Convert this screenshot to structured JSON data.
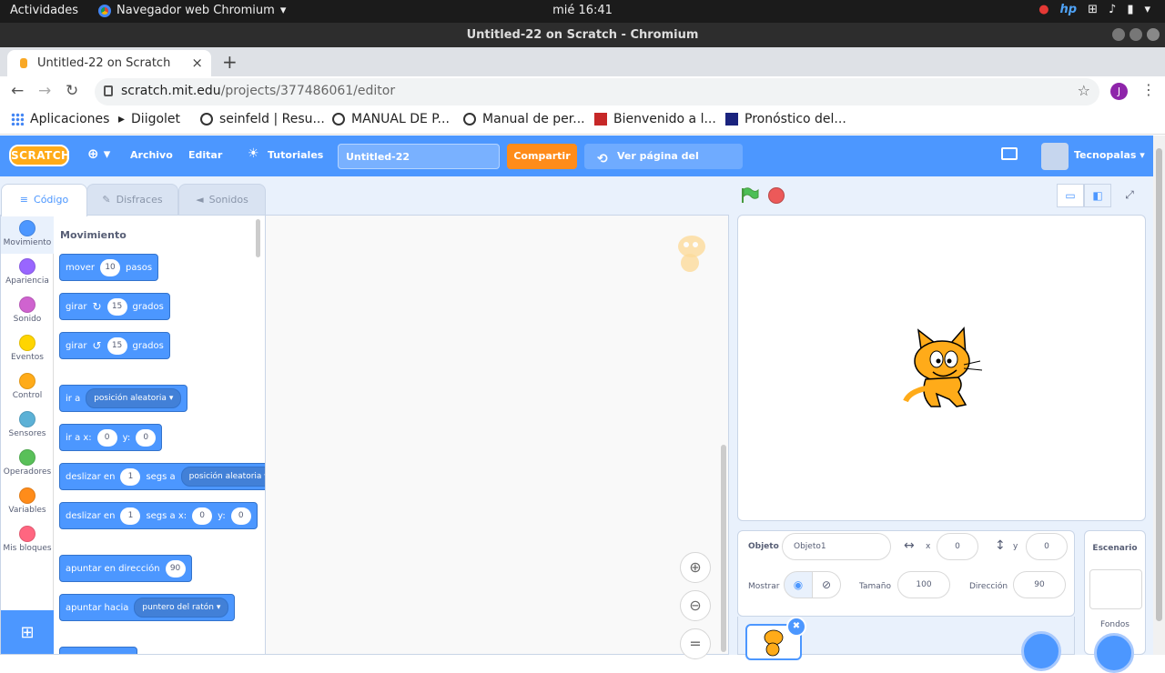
{
  "os": {
    "activities": "Actividades",
    "app_menu": "Navegador web Chromium",
    "clock": "mié 16:41"
  },
  "window": {
    "title": "Untitled-22 on Scratch - Chromium"
  },
  "browser": {
    "tab_title": "Untitled-22 on Scratch",
    "url_host": "scratch.mit.edu",
    "url_path": "/projects/377486061/editor",
    "profile_initial": "J",
    "bookmarks": [
      {
        "label": "Aplicaciones",
        "icon": "apps-grid-icon"
      },
      {
        "label": "Diigolet",
        "icon": "diigo-icon"
      },
      {
        "label": "seinfeld | Resu...",
        "icon": "globe-icon"
      },
      {
        "label": "MANUAL DE P...",
        "icon": "globe-icon"
      },
      {
        "label": "Manual de per...",
        "icon": "globe-icon"
      },
      {
        "label": "Bienvenido a l...",
        "icon": "red-site-icon"
      },
      {
        "label": "Pronóstico del...",
        "icon": "weather-site-icon"
      }
    ]
  },
  "scratch": {
    "logo": "SCRATCH",
    "menu": {
      "file": "Archivo",
      "edit": "Editar",
      "tutorials": "Tutoriales",
      "project_title": "Untitled-22",
      "share": "Compartir",
      "see_project": "Ver página del proyecto",
      "username": "Tecnopalas"
    },
    "tabs": {
      "code": "Código",
      "costumes": "Disfraces",
      "sounds": "Sonidos"
    },
    "categories": [
      {
        "label": "Movimiento",
        "color": "#4c97ff"
      },
      {
        "label": "Apariencia",
        "color": "#9966ff"
      },
      {
        "label": "Sonido",
        "color": "#cf63cf"
      },
      {
        "label": "Eventos",
        "color": "#ffd500"
      },
      {
        "label": "Control",
        "color": "#ffab19"
      },
      {
        "label": "Sensores",
        "color": "#5cb1d6"
      },
      {
        "label": "Operadores",
        "color": "#59c059"
      },
      {
        "label": "Variables",
        "color": "#ff8c1a"
      },
      {
        "label": "Mis bloques",
        "color": "#ff6680"
      }
    ],
    "palette": {
      "section": "Movimiento",
      "move": {
        "a": "mover",
        "v": "10",
        "b": "pasos"
      },
      "turn_right": {
        "a": "girar",
        "v": "15",
        "b": "grados"
      },
      "turn_left": {
        "a": "girar",
        "v": "15",
        "b": "grados"
      },
      "goto": {
        "a": "ir a",
        "dd": "posición aleatoria"
      },
      "gotoxy": {
        "a": "ir a x:",
        "x": "0",
        "b": "y:",
        "y": "0"
      },
      "glide": {
        "a": "deslizar en",
        "v": "1",
        "b": "segs a",
        "dd": "posición aleatoria"
      },
      "glidexy": {
        "a": "deslizar en",
        "v": "1",
        "b": "segs a x:",
        "x": "0",
        "c": "y:",
        "y": "0"
      },
      "point": {
        "a": "apuntar en dirección",
        "v": "90"
      },
      "pointtowards": {
        "a": "apuntar hacia",
        "dd": "puntero del ratón"
      }
    },
    "sprite": {
      "label_sprite": "Objeto",
      "name": "Objeto1",
      "label_x": "x",
      "x": "0",
      "label_y": "y",
      "y": "0",
      "label_show": "Mostrar",
      "label_size": "Tamaño",
      "size": "100",
      "label_direction": "Dirección",
      "direction": "90"
    },
    "stage_panel": {
      "title": "Escenario",
      "backdrops": "Fondos"
    }
  }
}
